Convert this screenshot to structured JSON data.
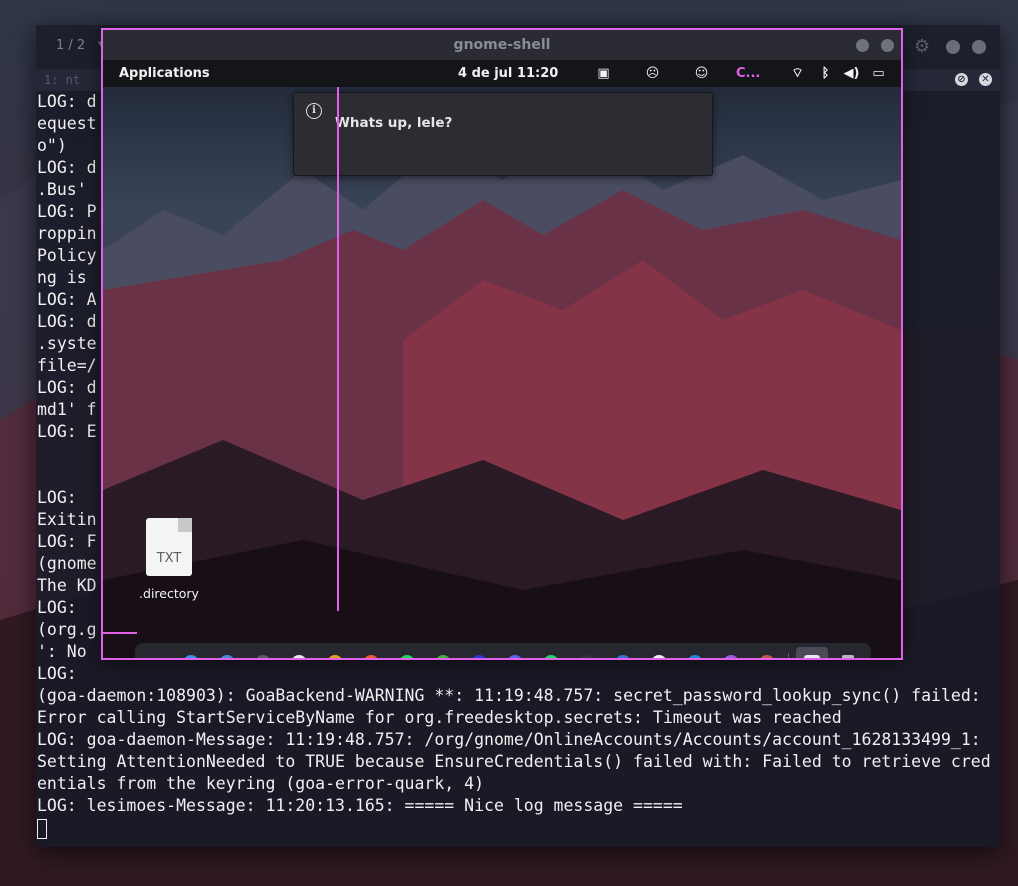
{
  "terminal": {
    "tab_counter": "1 / 2",
    "tab_label": "1: nt",
    "lines": [
      "LOG: d                                                     y.Bus' r",
      "equest                                                     i --platf",
      "o\")",
      "LOG: d                                                     'org.a11y",
      ".Bus'",
      "LOG: P                                                     5: Eavesd",
      "roppin",
      "Policy                                                     vesdroppi",
      "ng is",
      "LOG: A",
      "LOG: d                                                     reedesktop",
      ".syste                                                     --config-",
      "file=/",
      "LOG: d                                                     ktop.syste",
      "md1' f",
      "LOG: E                                                     or",
      "",
      "",
      "LOG:",
      "Exitin",
      "LOG: F",
      "(gnome                                                     icon for",
      "The KD",
      "LOG:",
      "(org.g                                                     isrunning",
      "': No",
      "LOG:",
      "(goa-daemon:108903): GoaBackend-WARNING **: 11:19:48.757: secret_password_lookup_sync() failed:",
      "Error calling StartServiceByName for org.freedesktop.secrets: Timeout was reached",
      "LOG: goa-daemon-Message: 11:19:48.757: /org/gnome/OnlineAccounts/Accounts/account_1628133499_1:",
      "Setting AttentionNeeded to TRUE because EnsureCredentials() failed with: Failed to retrieve cred",
      "entials from the keyring (goa-error-quark, 4)",
      "LOG: lesimoes-Message: 11:20:13.165: ===== Nice log message ====="
    ]
  },
  "gnome_shell": {
    "window_title": "gnome-shell",
    "topbar": {
      "applications_label": "Applications",
      "clock": "4 de jul  11:20",
      "tray_text": "C...",
      "tray_icons": [
        "window-switcher-icon",
        "sad-face-icon",
        "face-icon",
        "wifi-icon",
        "bluetooth-icon",
        "volume-icon",
        "battery-icon"
      ]
    },
    "notification": {
      "icon": "info-icon",
      "text": "Whats up, lele?"
    },
    "desktop_file": {
      "extension": "TXT",
      "name": ".directory"
    },
    "dock": {
      "items": [
        {
          "name": "app-grid-icon",
          "color": "#2a2b33"
        },
        {
          "name": "finder-icon",
          "color": "#3d8fe8"
        },
        {
          "name": "tasks-icon",
          "color": "#4a86d8"
        },
        {
          "name": "dark-circle-icon",
          "color": "#5a5c66"
        },
        {
          "name": "clock-icon",
          "color": "#e8e8ee"
        },
        {
          "name": "chrome-icon",
          "color": "#e0a020"
        },
        {
          "name": "calendar-icon",
          "color": "#e85a30"
        },
        {
          "name": "spotify-icon",
          "color": "#1ed760"
        },
        {
          "name": "photos-icon",
          "color": "#4aa848"
        },
        {
          "name": "media-player-icon",
          "color": "#2a3ad8"
        },
        {
          "name": "discord-icon",
          "color": "#5865f2"
        },
        {
          "name": "whatsapp-icon",
          "color": "#25d366"
        },
        {
          "name": "fan-icon",
          "color": "#30323c"
        },
        {
          "name": "simplenote-icon",
          "color": "#3a70d8"
        },
        {
          "name": "slack-icon",
          "color": "#f0f0f0"
        },
        {
          "name": "vscode-icon",
          "color": "#1e8ad8"
        },
        {
          "name": "color-picker-icon",
          "color": "#9a5ae0"
        },
        {
          "name": "gimp-icon",
          "color": "#c05a48"
        },
        {
          "name": "document-viewer-icon",
          "color": "#e8e8ee"
        },
        {
          "name": "trash-icon",
          "color": "#b8bac4"
        }
      ]
    }
  },
  "colors": {
    "accent_border": "#e060e8",
    "terminal_text": "#f0f0f0"
  }
}
